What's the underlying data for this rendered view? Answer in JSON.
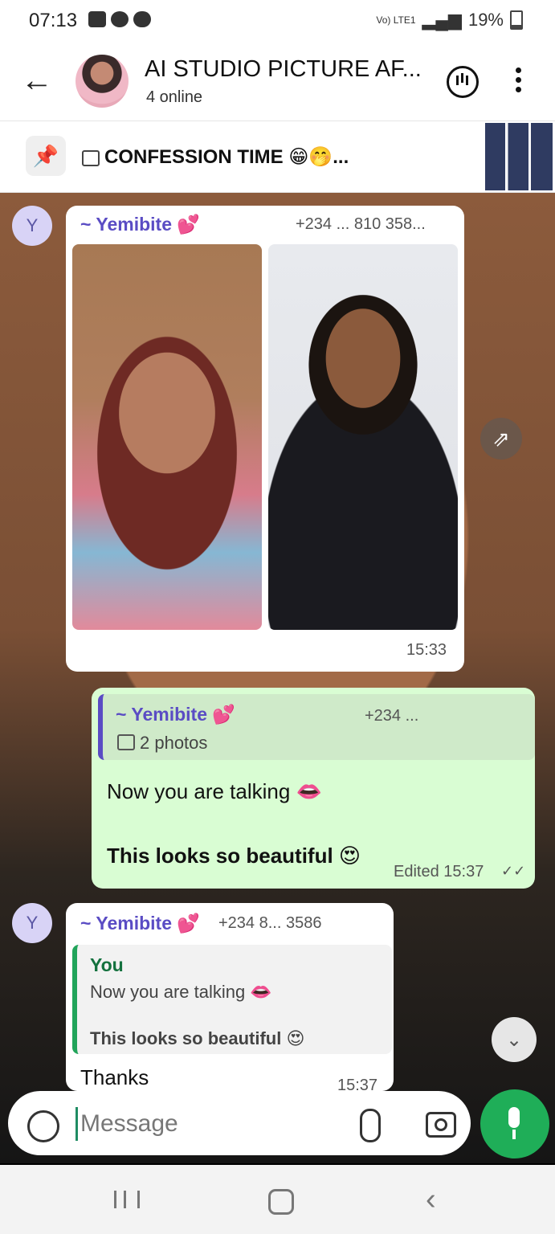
{
  "status_bar": {
    "time": "07:13",
    "battery": "19%",
    "network": "Vo) LTE1"
  },
  "header": {
    "back_icon": "arrow-left",
    "title": "AI STUDIO PICTURE AF...",
    "subtitle": "4 online",
    "voice_chat_icon": "voice-chat",
    "menu_icon": "kebab"
  },
  "pinned": {
    "text": "CONFESSION TIME 😁🤭..."
  },
  "messages": [
    {
      "avatar_letter": "Y",
      "sender": "~ Yemibite 💕",
      "phone": "+234 ... 810 358...",
      "time": "15:33"
    },
    {
      "quoted_sender": "~ Yemibite 💕",
      "quoted_phone": "+234 ...",
      "quoted_label": "2 photos",
      "line1": "Now you are talking 👄",
      "line2": "This looks so beautiful 😍",
      "status": "Edited 15:37"
    },
    {
      "avatar_letter": "Y",
      "sender": "~ Yemibite 💕",
      "phone": "+234 8... 3586",
      "quoted_sender": "You",
      "quoted_line1": "Now you are talking 👄",
      "quoted_line2": "This looks so beautiful 😍",
      "text": "Thanks",
      "time": "15:37"
    }
  ],
  "input": {
    "placeholder": "Message"
  },
  "colors": {
    "accent_green": "#1fae58",
    "sender_purple": "#5a4cc4",
    "outgoing_bubble": "#d9fdd3"
  }
}
